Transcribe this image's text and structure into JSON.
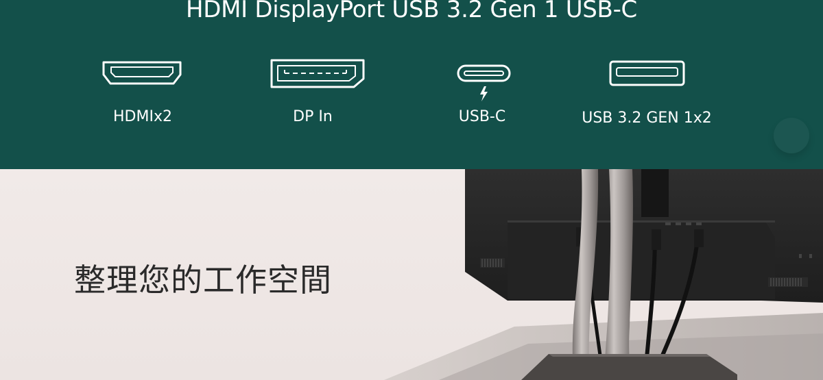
{
  "ports_section": {
    "heading": "HDMI DisplayPort USB 3.2 Gen 1 USB-C",
    "ports": [
      {
        "icon": "hdmi-port-icon",
        "label": "HDMIx2"
      },
      {
        "icon": "displayport-icon",
        "label": "DP In"
      },
      {
        "icon": "usb-c-icon",
        "label": "USB-C"
      },
      {
        "icon": "usb-a-icon",
        "label": "USB 3.2 GEN 1x2"
      }
    ]
  },
  "cable_section": {
    "heading": "整理您的工作空間"
  },
  "colors": {
    "band_green": "#13504a",
    "text_white": "#ffffff",
    "background_beige": "#efe8e6",
    "heading_dark": "#2a2a2a"
  }
}
